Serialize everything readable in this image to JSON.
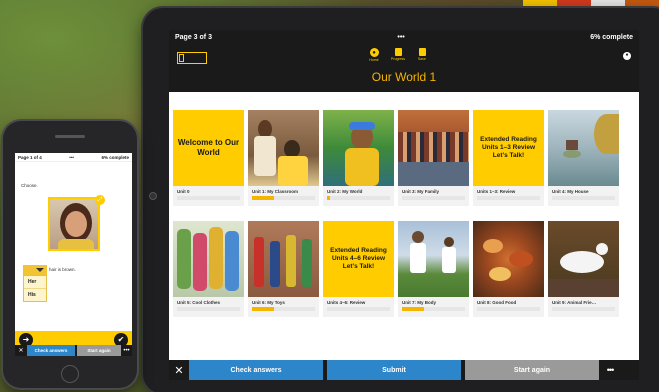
{
  "tablet": {
    "status": {
      "page": "Page 3 of 3",
      "dots": "•••",
      "progress": "6% complete"
    },
    "nav": [
      {
        "label": "Home",
        "icon": "home-icon"
      },
      {
        "label": "Progress",
        "icon": "progress-icon"
      },
      {
        "label": "Save",
        "icon": "save-icon"
      }
    ],
    "title": "Our World 1",
    "tiles": [
      {
        "caption": "Unit 0",
        "banner": "Welcome to Our World",
        "progress": 0
      },
      {
        "caption": "Unit 1: My Classroom",
        "banner": "",
        "progress": 0.35
      },
      {
        "caption": "Unit 2: My World",
        "banner": "",
        "progress": 0.05
      },
      {
        "caption": "Unit 3: My Family",
        "banner": "",
        "progress": 0
      },
      {
        "caption": "Units 1–3: Review",
        "banner": "Extended Reading Units 1–3 Review Let’s Talk!",
        "progress": 0
      },
      {
        "caption": "Unit 4: My House",
        "banner": "",
        "progress": 0
      },
      {
        "caption": "Unit 5: Cool Clothes",
        "banner": "",
        "progress": 0
      },
      {
        "caption": "Unit 6: My Toys",
        "banner": "",
        "progress": 0.35
      },
      {
        "caption": "Units 4–6: Review",
        "banner": "Extended Reading Units 4–6 Review Let’s Talk!",
        "progress": 0
      },
      {
        "caption": "Unit 7: My Body",
        "banner": "",
        "progress": 0.35
      },
      {
        "caption": "Unit 8: Good Food",
        "banner": "",
        "progress": 0
      },
      {
        "caption": "Unit 9: Animal Frie…",
        "banner": "",
        "progress": 0
      }
    ],
    "footer": {
      "check": "Check answers",
      "submit": "Submit",
      "again": "Start again",
      "more": "•••"
    }
  },
  "phone": {
    "status": {
      "page": "Page 1 of 4",
      "dots": "•••",
      "progress": "6% complete"
    },
    "prompt": "Choose.",
    "sentence_rest": "hair is brown.",
    "options": [
      "Her",
      "His"
    ],
    "footer": {
      "check": "Check answers",
      "again": "Start again",
      "more": "•••"
    }
  },
  "colors": {
    "accent": "#ffcc00",
    "title": "#f5b400",
    "blue": "#2d86c9",
    "grey": "#9a9a9a",
    "dark": "#1a1a1a"
  }
}
